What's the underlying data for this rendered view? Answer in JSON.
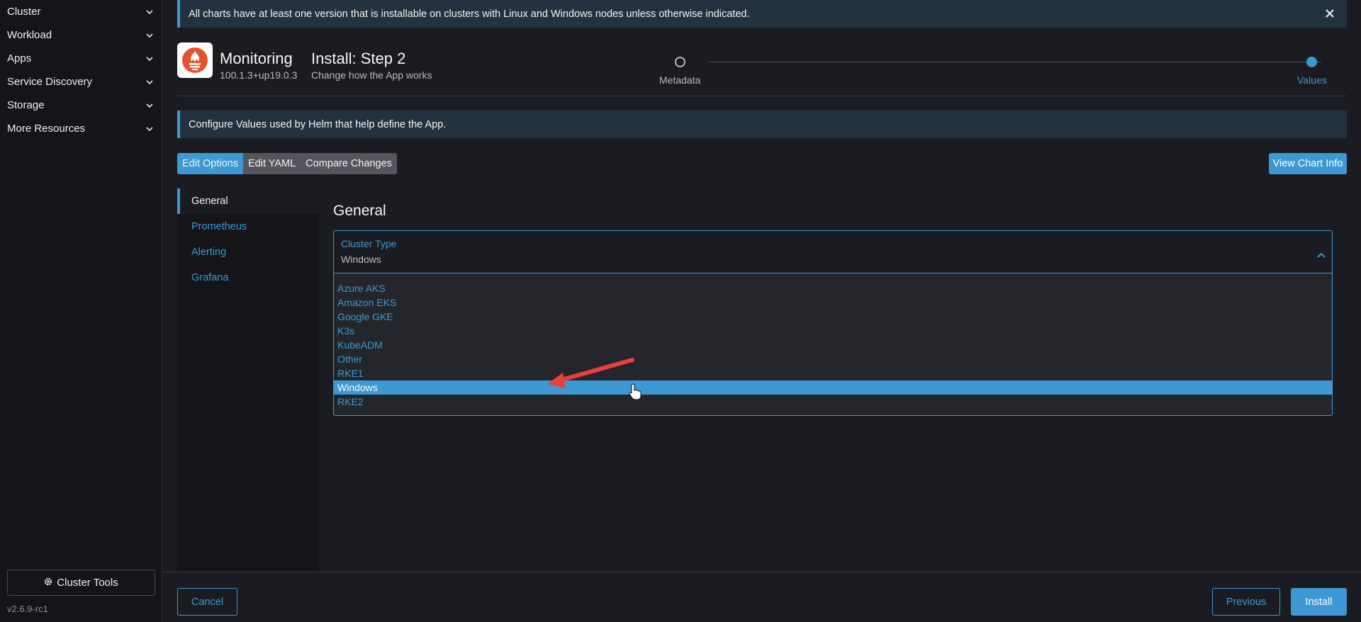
{
  "sidebar": {
    "items": [
      {
        "label": "Cluster"
      },
      {
        "label": "Workload"
      },
      {
        "label": "Apps"
      },
      {
        "label": "Service Discovery"
      },
      {
        "label": "Storage"
      },
      {
        "label": "More Resources"
      }
    ],
    "cluster_tools_label": "Cluster Tools",
    "version": "v2.6.9-rc1"
  },
  "banner": {
    "text": "All charts have at least one version that is installable on clusters with Linux and Windows nodes unless otherwise indicated."
  },
  "app": {
    "name": "Monitoring",
    "version": "100.1.3+up19.0.3"
  },
  "step": {
    "title": "Install: Step 2",
    "subtitle": "Change how the App works",
    "steps": [
      {
        "label": "Metadata"
      },
      {
        "label": "Values"
      }
    ]
  },
  "info": {
    "text": "Configure Values used by Helm that help define the App."
  },
  "toolbar": {
    "edit_options": "Edit Options",
    "edit_yaml": "Edit YAML",
    "compare_changes": "Compare Changes",
    "view_chart_info": "View Chart Info"
  },
  "tabs": [
    {
      "label": "General"
    },
    {
      "label": "Prometheus"
    },
    {
      "label": "Alerting"
    },
    {
      "label": "Grafana"
    }
  ],
  "section": {
    "title": "General"
  },
  "cluster_type": {
    "label": "Cluster Type",
    "value": "Windows",
    "options": [
      "Azure AKS",
      "Amazon EKS",
      "Google GKE",
      "K3s",
      "KubeADM",
      "Other",
      "RKE1",
      "Windows",
      "RKE2"
    ]
  },
  "footer": {
    "cancel": "Cancel",
    "previous": "Previous",
    "install": "Install"
  },
  "colors": {
    "accent": "#3d98d3",
    "background": "#1b1c21",
    "sidebar": "#141419",
    "annotation_arrow": "#e8413d"
  }
}
